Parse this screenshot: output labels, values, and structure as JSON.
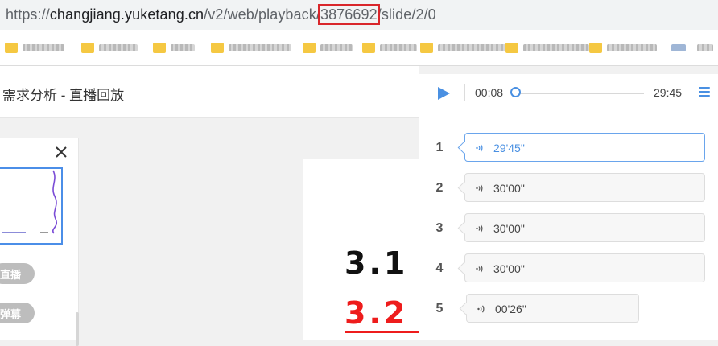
{
  "browser": {
    "url_prefix": "https://",
    "url_host": "changjiang.yuketang.cn",
    "url_path_a": "/v2/web/playback/",
    "url_highlight": "3876692",
    "url_path_b": "/slide/2/0"
  },
  "page": {
    "title": "需求分析 - 直播回放"
  },
  "left_panel": {
    "pill_live": "直播",
    "pill_danmaku": "弹幕"
  },
  "slide": {
    "line1": "3.1",
    "line2": "3.2"
  },
  "player": {
    "current_time": "00:08",
    "total_time": "29:45",
    "progress": 0.004,
    "segments": [
      {
        "index": "1",
        "duration": "29'45\"",
        "active": true
      },
      {
        "index": "2",
        "duration": "30'00\"",
        "active": false
      },
      {
        "index": "3",
        "duration": "30'00\"",
        "active": false
      },
      {
        "index": "4",
        "duration": "30'00\"",
        "active": false
      },
      {
        "index": "5",
        "duration": "00'26\"",
        "active": false
      }
    ]
  },
  "colors": {
    "accent": "#4a90e2",
    "url_highlight_border": "#d9262b",
    "slide_red": "#ee1c1c"
  }
}
